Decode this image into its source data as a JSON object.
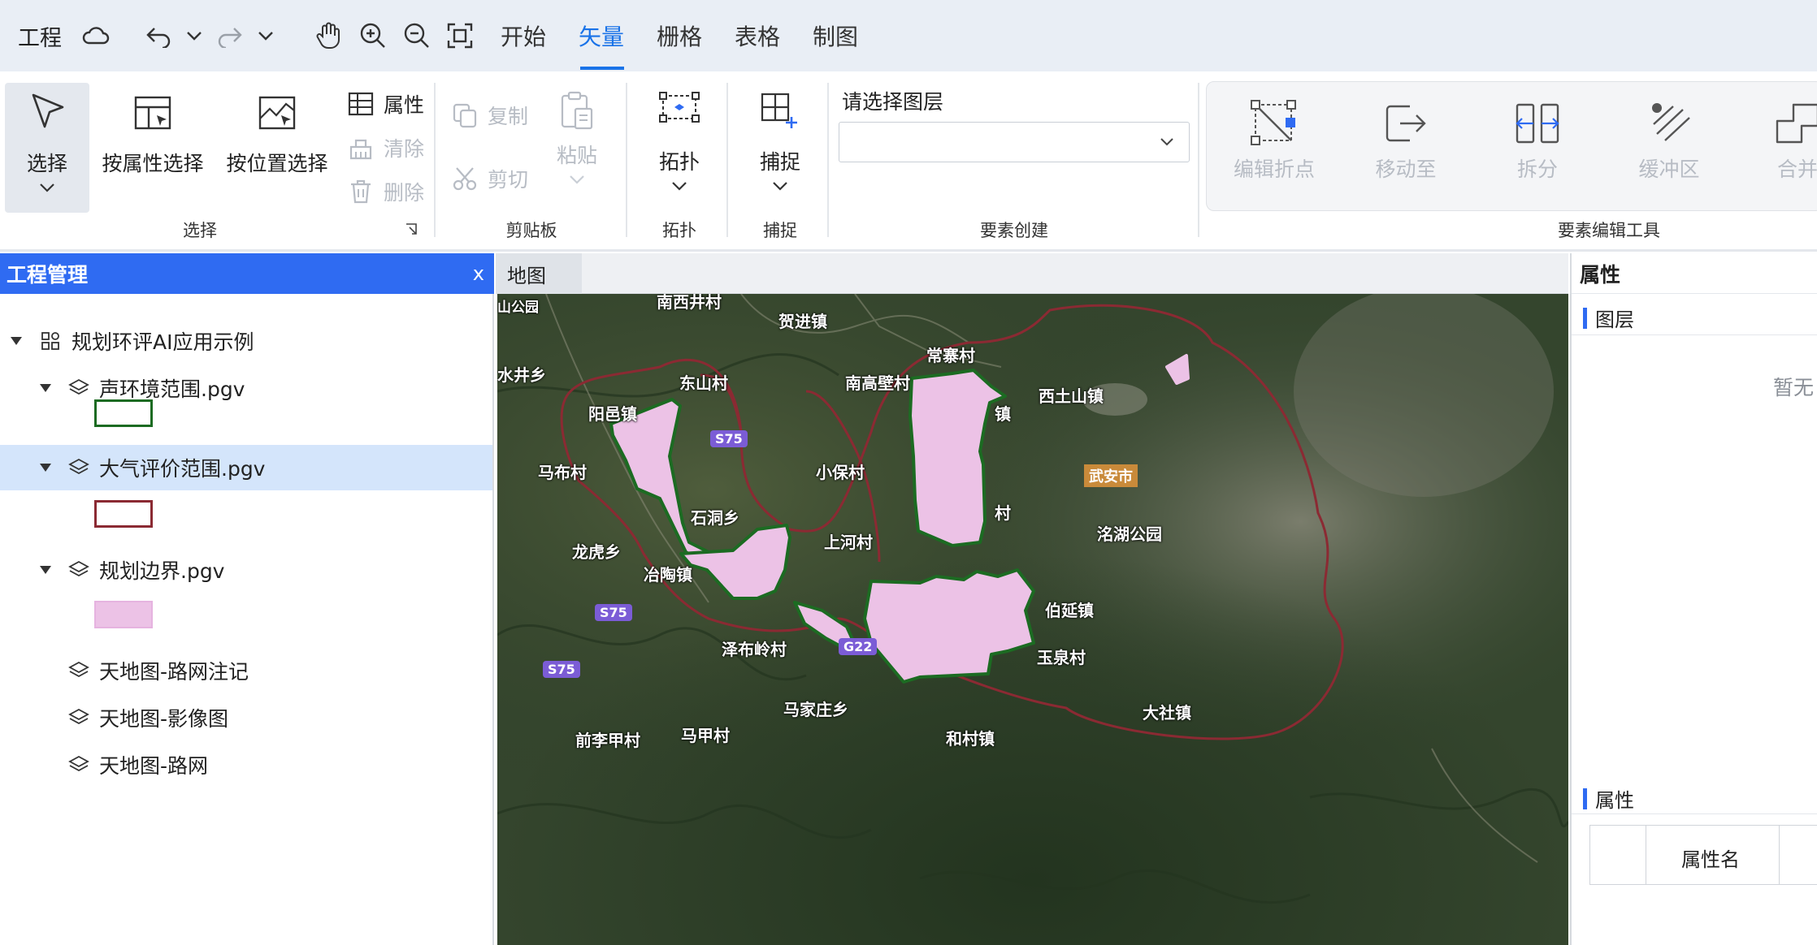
{
  "menubar": {
    "project": "工程",
    "tabs": [
      {
        "label": "开始",
        "active": false
      },
      {
        "label": "矢量",
        "active": true
      },
      {
        "label": "栅格",
        "active": false
      },
      {
        "label": "表格",
        "active": false
      },
      {
        "label": "制图",
        "active": false
      }
    ],
    "accent_color": "#1a73e8"
  },
  "ribbon": {
    "select_group": {
      "select": "选择",
      "select_by_attr": "按属性选择",
      "select_by_location": "按位置选择",
      "attributes": "属性",
      "clear": "清除",
      "delete": "删除",
      "group_label": "选择"
    },
    "clipboard_group": {
      "copy": "复制",
      "paste": "粘贴",
      "cut": "剪切",
      "group_label": "剪贴板"
    },
    "topology_group": {
      "topology": "拓扑",
      "group_label": "拓扑"
    },
    "snap_group": {
      "snap": "捕捉",
      "group_label": "捕捉"
    },
    "create_group": {
      "prompt": "请选择图层",
      "selected_layer": "",
      "group_label": "要素创建"
    },
    "edit_tools_group": {
      "tools": [
        "编辑折点",
        "移动至",
        "拆分",
        "缓冲区",
        "合并"
      ],
      "group_label": "要素编辑工具"
    }
  },
  "project_panel": {
    "title": "工程管理",
    "close": "x",
    "root": "规划环评AI应用示例",
    "layers": [
      {
        "name": "声环境范围.pgv",
        "legend_fill": "#ffffff",
        "legend_stroke": "#1c6b22",
        "selected": false
      },
      {
        "name": "大气评价范围.pgv",
        "legend_fill": "#ffffff",
        "legend_stroke": "#8b2a33",
        "selected": true
      },
      {
        "name": "规划边界.pgv",
        "legend_fill": "#ecc2e6",
        "legend_stroke": "#e6b3e0",
        "selected": false
      },
      {
        "name": "天地图-路网注记"
      },
      {
        "name": "天地图-影像图"
      },
      {
        "name": "天地图-路网"
      }
    ]
  },
  "map": {
    "tab": "地图",
    "places": [
      "南西井村",
      "贺进镇",
      "常寨村",
      "东山村",
      "南高壁村",
      "西土山镇",
      "阳邑镇",
      "马布村",
      "小保村",
      "武安市",
      "石洞乡",
      "上河村",
      "龙虎乡",
      "冶陶镇",
      "伯延镇",
      "洺湖公园",
      "泽布岭村",
      "玉泉村",
      "马家庄乡",
      "大社镇",
      "马甲村",
      "前李甲村",
      "和村镇",
      "水井乡",
      "山公园",
      "镇",
      "村"
    ],
    "roads": [
      "S75",
      "S75",
      "S75",
      "G22"
    ]
  },
  "properties_panel": {
    "title": "属性",
    "layer_section": "图层",
    "empty_text": "暂无",
    "attr_section": "属性",
    "table_header": "属性名"
  }
}
